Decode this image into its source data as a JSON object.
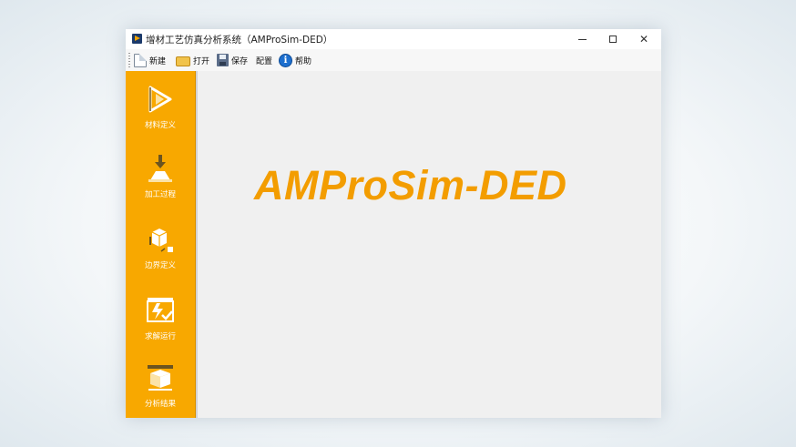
{
  "window": {
    "title": "增材工艺仿真分析系统（AMProSim-DED）",
    "controls": {
      "minimize": "",
      "maximize": "",
      "close": "✕"
    }
  },
  "toolbar": {
    "items": [
      {
        "label": "新建",
        "icon": "new-file-icon"
      },
      {
        "label": "打开",
        "icon": "folder-icon"
      },
      {
        "label": "保存",
        "icon": "save-icon"
      },
      {
        "label": "配置",
        "icon": ""
      },
      {
        "label": "帮助",
        "icon": "info-icon"
      }
    ]
  },
  "sidebar": {
    "items": [
      {
        "label": "材料定义",
        "icon": "material-icon"
      },
      {
        "label": "加工过程",
        "icon": "process-icon"
      },
      {
        "label": "边界定义",
        "icon": "boundary-icon"
      },
      {
        "label": "求解运行",
        "icon": "solve-icon"
      },
      {
        "label": "分析结果",
        "icon": "results-icon"
      }
    ]
  },
  "main": {
    "brand": "AMProSim-DED"
  },
  "colors": {
    "accent": "#f8a800",
    "brand": "#f39d00"
  }
}
